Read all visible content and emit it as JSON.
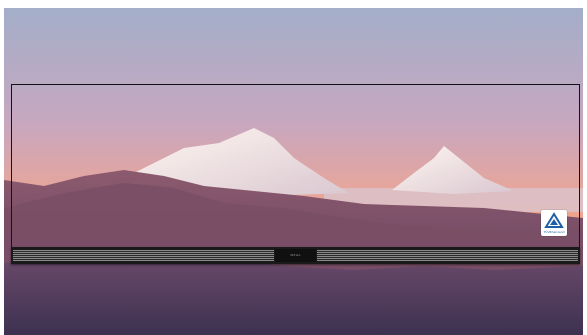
{
  "image": {
    "subject": "mountain-landscape-tv-display",
    "colors": {
      "sky_top": "#9aa5c7",
      "sky_mid": "#d6a3ad",
      "sky_horizon": "#f3a17a",
      "peak_snow": "#fbf3f1",
      "foothills": "#6b4560",
      "foreground": "#4b3a5c",
      "soundbar": "#1a1a1a"
    }
  },
  "soundbar": {
    "brand_text": "WEGA"
  },
  "badge": {
    "icon": "tuv-certification-icon",
    "text": "TÜVRheinland"
  }
}
